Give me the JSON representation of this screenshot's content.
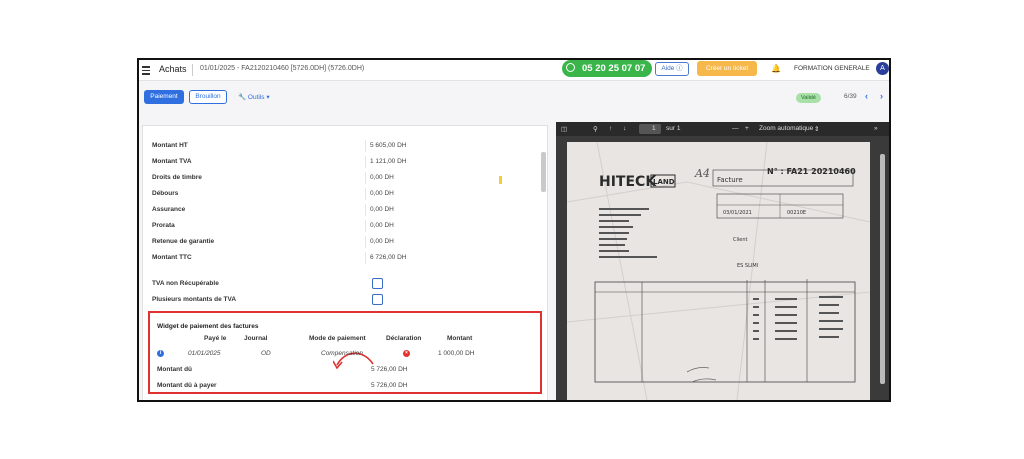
{
  "topbar": {
    "app_title": "Achats",
    "breadcrumb": "01/01/2025 - FA2120210460 [5726.0DH] (5726.0DH)",
    "phone": "05 20 25 07 07",
    "help_label": "Aide",
    "ticket_label": "Créer un ticket",
    "company": "FORMATION GENERALE",
    "avatar": "A"
  },
  "actions": {
    "pay_label": "Paiement",
    "draft_label": "Brouillon",
    "tools_label": "Outils",
    "status": "Validé",
    "pager": "6/39"
  },
  "form": {
    "rows": [
      {
        "label": "Montant HT",
        "value": "5 605,00 DH"
      },
      {
        "label": "Montant TVA",
        "value": "1 121,00 DH"
      },
      {
        "label": "Droits de timbre",
        "value": "0,00 DH"
      },
      {
        "label": "Débours",
        "value": "0,00 DH"
      },
      {
        "label": "Assurance",
        "value": "0,00 DH"
      },
      {
        "label": "Prorata",
        "value": "0,00 DH"
      },
      {
        "label": "Retenue de garantie",
        "value": "0,00 DH"
      },
      {
        "label": "Montant TTC",
        "value": "6 726,00 DH"
      }
    ],
    "checks": [
      {
        "label": "TVA non Récupérable"
      },
      {
        "label": "Plusieurs montants de TVA"
      }
    ]
  },
  "widget": {
    "title": "Widget de paiement des factures",
    "headers": [
      "Payé le",
      "Journal",
      "Mode de paiement",
      "Déclaration",
      "Montant"
    ],
    "row": {
      "date": "01/01/2025",
      "journal": "OD",
      "mode": "Compensation",
      "amount": "1 000,00 DH"
    },
    "due_label": "Montant dû",
    "due_value": "5 726,00 DH",
    "to_pay_label": "Montant dû à payer",
    "to_pay_value": "5 726,00 DH"
  },
  "pdf": {
    "page": "1",
    "total": "sur 1",
    "zoom": "Zoom automatique",
    "zoom_out": "—",
    "zoom_in": "+",
    "doc_brand": "HITECK",
    "doc_brand_box": "LAND",
    "doc_handwritten": "A4",
    "doc_number": "N° : FA21 20210460",
    "doc_type": "Facture",
    "doc_date": "03/01/2021",
    "doc_code": "00210E",
    "doc_client": "Client",
    "doc_city": "ES SLIMI"
  },
  "icons": {
    "menu": "hamburger-icon",
    "phone": "phone-icon",
    "help": "question-circle-icon",
    "bell": "bell-icon",
    "tools": "wrench-icon",
    "info": "info-icon",
    "cancel": "cross-circle-icon",
    "sidebar": "sidebar-toggle-icon",
    "search": "search-icon",
    "up": "arrow-up-icon",
    "down": "arrow-down-icon"
  },
  "colors": {
    "primary": "#2f6fe0",
    "phone_bg": "#3ab54a",
    "ticket_bg": "#f6b84a",
    "highlight": "#e03131",
    "status_bg": "#a8e0a8"
  }
}
